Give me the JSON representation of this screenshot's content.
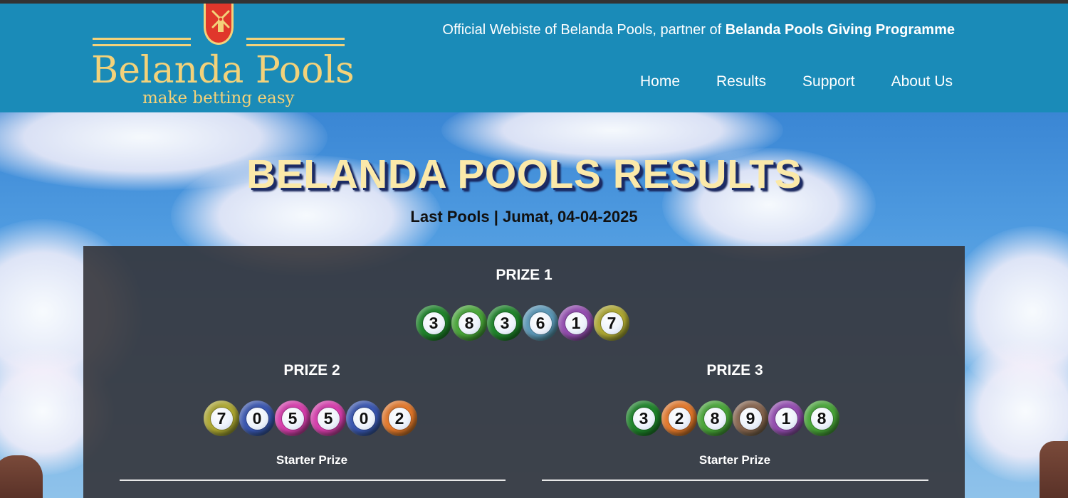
{
  "header": {
    "brand": "Belanda Pools",
    "tagline": "make betting easy",
    "official_prefix": "Official Webiste of Belanda Pools, partner of ",
    "official_bold": "Belanda Pools Giving Programme",
    "nav": [
      "Home",
      "Results",
      "Support",
      "About Us"
    ]
  },
  "main": {
    "title": "BELANDA POOLS RESULTS",
    "subtitle": "Last Pools | Jumat, 04-04-2025"
  },
  "results": {
    "prize1": {
      "label": "PRIZE 1",
      "balls": [
        {
          "digit": "3",
          "color": "#1f8a2b"
        },
        {
          "digit": "8",
          "color": "#4cae3a"
        },
        {
          "digit": "3",
          "color": "#1f8a2b"
        },
        {
          "digit": "6",
          "color": "#5f9fc0"
        },
        {
          "digit": "1",
          "color": "#9b4fb8"
        },
        {
          "digit": "7",
          "color": "#b7b033"
        }
      ]
    },
    "prize2": {
      "label": "PRIZE 2",
      "starter": "Starter Prize",
      "balls": [
        {
          "digit": "7",
          "color": "#b7b033"
        },
        {
          "digit": "0",
          "color": "#3b59b8"
        },
        {
          "digit": "5",
          "color": "#e23fb4"
        },
        {
          "digit": "5",
          "color": "#e23fb4"
        },
        {
          "digit": "0",
          "color": "#3b59b8"
        },
        {
          "digit": "2",
          "color": "#ef7d2b"
        }
      ]
    },
    "prize3": {
      "label": "PRIZE 3",
      "starter": "Starter Prize",
      "balls": [
        {
          "digit": "3",
          "color": "#1f8a2b"
        },
        {
          "digit": "2",
          "color": "#ef7d2b"
        },
        {
          "digit": "8",
          "color": "#4cae3a"
        },
        {
          "digit": "9",
          "color": "#8e6a52"
        },
        {
          "digit": "1",
          "color": "#9b4fb8"
        },
        {
          "digit": "8",
          "color": "#4cae3a"
        }
      ]
    }
  },
  "colors": {
    "header_bg": "#1a8bb8",
    "brand_gold": "#f3d27a",
    "title_color": "#fbe9a9",
    "panel_bg": "#34343a"
  }
}
